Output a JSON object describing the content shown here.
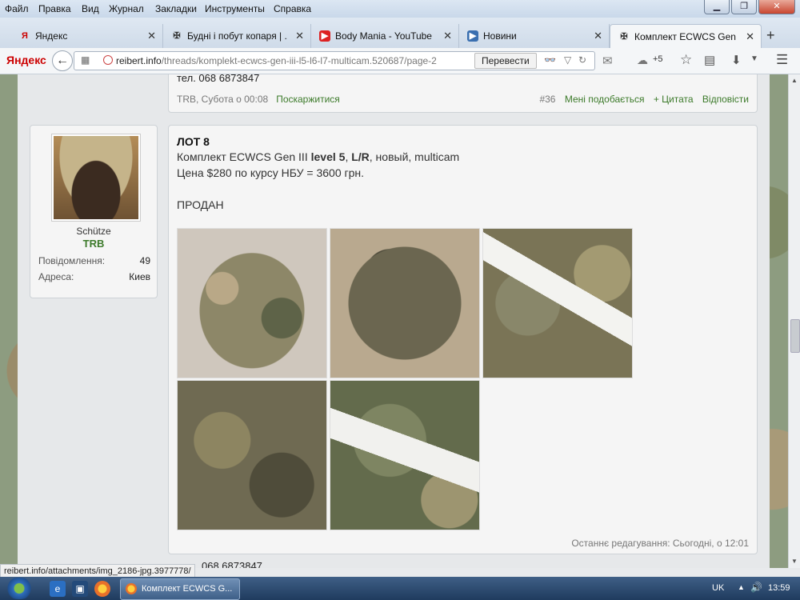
{
  "menu": [
    "Файл",
    "Правка",
    "Вид",
    "Журнал",
    "Закладки",
    "Инструменты",
    "Справка"
  ],
  "window_buttons": {
    "minimize": "▁",
    "maximize": "❐",
    "close": "✕"
  },
  "tabs": [
    {
      "label": "Яндекс",
      "icon": "Я"
    },
    {
      "label": "Будні і побут копаря | ...",
      "icon": "✠"
    },
    {
      "label": "Body Mania - YouTube",
      "icon": "▶"
    },
    {
      "label": "Новини",
      "icon": "▶"
    },
    {
      "label": "Комплект ECWCS Gen II...",
      "icon": "✠"
    }
  ],
  "nav": {
    "logo": "Яндекс",
    "url_host": "reibert.info",
    "url_path": "/threads/komplekt-ecwcs-gen-iii-l5-l6-l7-multicam.520687/page-2",
    "translate": "Перевести",
    "cloud_count": "+5"
  },
  "prev_post": {
    "phone": "тел. 068 6873847",
    "author": "TRB",
    "time": "Субота о 00:08",
    "report": "Поскаржитися",
    "number": "#36",
    "like": "Мені подобається",
    "quote": "+ Цитата",
    "reply": "Відповісти"
  },
  "user": {
    "name": "Schütze",
    "role": "TRB",
    "stats": [
      {
        "label": "Повідомлення:",
        "value": "49"
      },
      {
        "label": "Адреса:",
        "value": "Киев"
      }
    ]
  },
  "post": {
    "title": "ЛОТ 8",
    "line2_a": "Комплект ECWCS Gen III ",
    "line2_b": "level 5",
    "line2_c": ", ",
    "line2_d": "L/R",
    "line2_e": ", новый, multicam",
    "line3": "Цена $280 по курсу НБУ = 3600 грн.",
    "line4": "ПРОДАН",
    "edited": "Останнє редагування: Сьогодні, о 12:01"
  },
  "next_post": {
    "phone": "068 6873847"
  },
  "status_url": "reibert.info/attachments/img_2186-jpg.3977778/",
  "taskbar": {
    "item": "Комплект ECWCS G...",
    "lang": "UK",
    "time": "13:59"
  }
}
